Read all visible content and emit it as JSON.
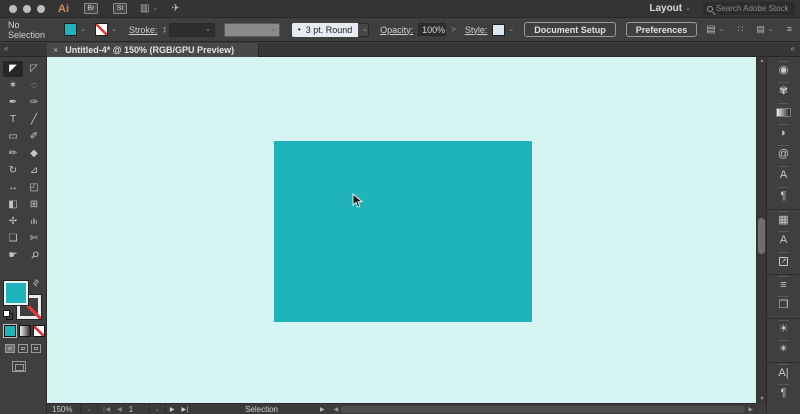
{
  "colors": {
    "fill_teal": "#1FB3BA",
    "canvas_bg": "#D6F5F2",
    "none_red": "#E03A3A",
    "logo_orange": "#D2895A"
  },
  "ui": {
    "chevron": "⌄",
    "step_up": "▴",
    "step_down": "▾",
    "swap": "⇄",
    "scroll_up": "▲",
    "scroll_down": "▼",
    "scroll_left": "◀",
    "scroll_right": "▶"
  },
  "topbar": {
    "logo": "Ai",
    "bridge": "Br",
    "stock": "St",
    "arrange_icon": "▥",
    "gpu_icon": "✈",
    "layout_menu": "Layout",
    "search_placeholder": "Search Adobe Stock"
  },
  "controlbar": {
    "selection_status": "No Selection",
    "stroke_label": "Stroke:",
    "brush_bullet": "•",
    "brush_value": "3 pt. Round",
    "opacity_label": "Opacity:",
    "opacity_value": "100%",
    "opacity_arrow": ">",
    "style_label": "Style:",
    "document_setup": "Document Setup",
    "preferences": "Preferences",
    "panel_icon": "▤",
    "touch_icon": "∷",
    "dock_icon": "▤",
    "menu_icon": "≡"
  },
  "tabbar": {
    "collapse_left": "«",
    "collapse_right": "«",
    "close": "×",
    "title": "Untitled-4* @ 150% (RGB/GPU Preview)"
  },
  "toolbar": {
    "tools": [
      {
        "name": "selection",
        "glyph": "◤",
        "selected": true
      },
      {
        "name": "direct-selection",
        "glyph": "◸"
      },
      {
        "name": "magic-wand",
        "glyph": "✶"
      },
      {
        "name": "lasso",
        "glyph": "◌"
      },
      {
        "name": "pen",
        "glyph": "✒"
      },
      {
        "name": "curvature",
        "glyph": "✑"
      },
      {
        "name": "type",
        "glyph": "T"
      },
      {
        "name": "line-segment",
        "glyph": "╱"
      },
      {
        "name": "rectangle",
        "glyph": "▭"
      },
      {
        "name": "paintbrush",
        "glyph": "✐"
      },
      {
        "name": "pencil",
        "glyph": "✏"
      },
      {
        "name": "eraser",
        "glyph": "◆"
      },
      {
        "name": "rotate",
        "glyph": "↻"
      },
      {
        "name": "scale",
        "glyph": "⊿"
      },
      {
        "name": "width",
        "glyph": "↔"
      },
      {
        "name": "free-transform",
        "glyph": "◰"
      },
      {
        "name": "shape-builder",
        "glyph": "◧"
      },
      {
        "name": "perspective-grid",
        "glyph": "⊞"
      },
      {
        "name": "symbol-sprayer",
        "glyph": "✢"
      },
      {
        "name": "column-graph",
        "glyph": "ıllı"
      },
      {
        "name": "artboard",
        "glyph": "❏"
      },
      {
        "name": "slice",
        "glyph": "✄"
      },
      {
        "name": "hand",
        "glyph": "☛"
      },
      {
        "name": "zoom",
        "glyph": "⚲",
        "rotate": true
      }
    ]
  },
  "rightpanel": {
    "icons": [
      {
        "name": "color",
        "glyph": "◉"
      },
      {
        "name": "color-guide",
        "glyph": "✾"
      },
      {
        "name": "gradient",
        "glyph": "",
        "cls": "grad"
      },
      {
        "name": "stroke",
        "glyph": "◗"
      },
      {
        "name": "libraries",
        "glyph": "@"
      },
      {
        "name": "character-styles",
        "glyph": "A"
      },
      {
        "name": "paragraph-styles",
        "glyph": "¶"
      },
      {
        "name": "swatches",
        "glyph": "▦",
        "sep": true
      },
      {
        "name": "glyphs",
        "glyph": "A"
      },
      {
        "name": "export",
        "glyph": "↗",
        "cls": "boxed"
      },
      {
        "name": "align",
        "glyph": "≡",
        "sep": true
      },
      {
        "name": "pathfinder",
        "glyph": "❐"
      },
      {
        "name": "appearance",
        "glyph": "☀",
        "sep": true
      },
      {
        "name": "graphic-styles",
        "glyph": "✴"
      },
      {
        "name": "character",
        "glyph": "A|",
        "sep": true
      },
      {
        "name": "paragraph",
        "glyph": "¶"
      }
    ]
  },
  "statusbar": {
    "zoom": "150%",
    "first": "❘◀",
    "prev": "◀",
    "artboard": "1",
    "next": "▶",
    "last": "▶❘",
    "status": "Selection",
    "flyout": "▶"
  }
}
